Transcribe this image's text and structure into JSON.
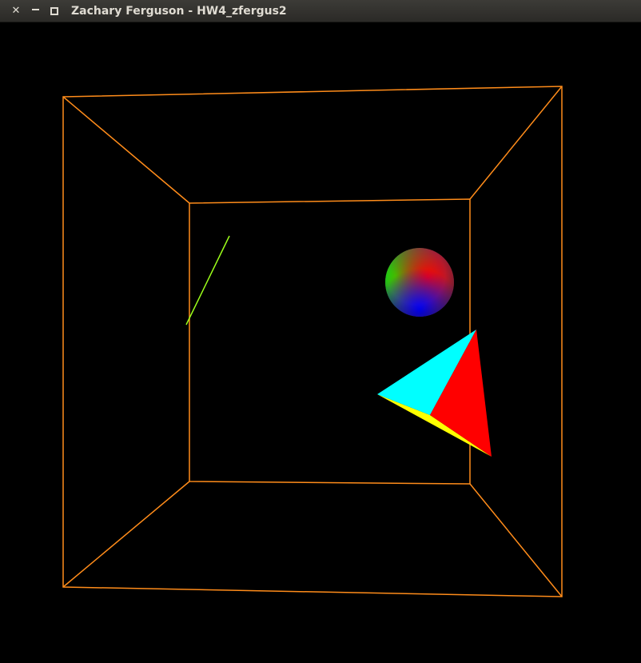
{
  "window": {
    "title": "Zachary Ferguson - HW4_zfergus2",
    "buttons": {
      "close": "✕",
      "minimize": "minimize",
      "maximize": "maximize"
    }
  },
  "scene": {
    "background": "#000000",
    "room_color": "#ff8c1a",
    "line_color": "#9cff1a",
    "sphere_colors": [
      "#ff0000",
      "#00ff00",
      "#0000ff"
    ],
    "tetrahedron_colors": [
      "#00ffff",
      "#ff0000",
      "#ffff00"
    ]
  }
}
